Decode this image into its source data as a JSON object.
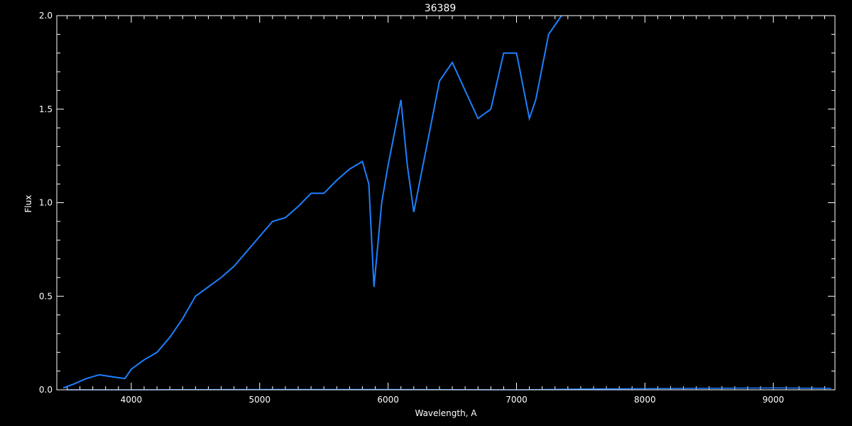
{
  "chart_data": {
    "type": "line",
    "title": "36389",
    "xlabel": "Wavelength, A",
    "ylabel": "Flux",
    "xlim": [
      3420,
      9480
    ],
    "ylim": [
      0,
      2.0
    ],
    "xticks": [
      4000,
      5000,
      6000,
      7000,
      8000,
      9000
    ],
    "yticks": [
      "0.0",
      "0.5",
      "1.0",
      "1.5",
      "2.0"
    ],
    "grid": false,
    "colors": {
      "background": "#000000",
      "axes": "#ffffff",
      "series": "#1e7fff"
    },
    "series": [
      {
        "role": "spectrum",
        "x": [
          3470,
          3550,
          3650,
          3750,
          3850,
          3950,
          4000,
          4100,
          4200,
          4300,
          4400,
          4500,
          4600,
          4700,
          4800,
          4900,
          5000,
          5100,
          5200,
          5300,
          5400,
          5500,
          5600,
          5700,
          5800,
          5850,
          5890,
          5950,
          6000,
          6100,
          6150,
          6200,
          6300,
          6400,
          6500,
          6600,
          6700,
          6800,
          6900,
          7000,
          7100,
          7150,
          7250,
          7350
        ],
        "y": [
          0.01,
          0.03,
          0.06,
          0.08,
          0.07,
          0.06,
          0.11,
          0.16,
          0.2,
          0.28,
          0.38,
          0.5,
          0.55,
          0.6,
          0.66,
          0.74,
          0.82,
          0.9,
          0.92,
          0.98,
          1.05,
          1.05,
          1.12,
          1.18,
          1.22,
          1.1,
          0.55,
          1.0,
          1.2,
          1.55,
          1.2,
          0.95,
          1.3,
          1.65,
          1.75,
          1.6,
          1.45,
          1.5,
          1.8,
          1.8,
          1.45,
          1.55,
          1.9,
          2.0
        ]
      },
      {
        "role": "baseline",
        "x": [
          3500,
          4000,
          5000,
          6000,
          7000,
          7500,
          8000,
          8500,
          9000,
          9450
        ],
        "y": [
          0.0,
          0.0,
          0.002,
          0.002,
          0.0,
          0.004,
          0.006,
          0.008,
          0.01,
          0.008
        ]
      }
    ]
  }
}
